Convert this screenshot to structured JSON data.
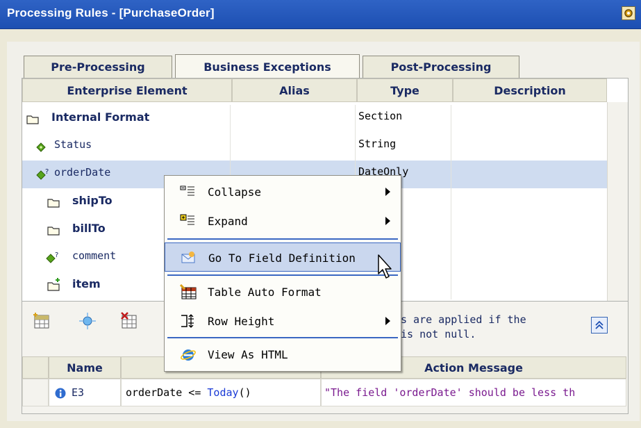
{
  "window": {
    "title": "Processing Rules - [PurchaseOrder]",
    "settings_icon": "gear-icon"
  },
  "tabs": [
    {
      "label": "Pre-Processing",
      "active": false
    },
    {
      "label": "Business Exceptions",
      "active": true
    },
    {
      "label": "Post-Processing",
      "active": false
    }
  ],
  "grid": {
    "columns": [
      "Enterprise Element",
      "Alias",
      "Type",
      "Description"
    ],
    "rows": [
      {
        "name": "Internal Format",
        "icon": "folder-icon",
        "type": "Section",
        "bold": true
      },
      {
        "name": "Status",
        "icon": "diamond-icon",
        "type": "String",
        "bold": false
      },
      {
        "name": "orderDate",
        "icon": "diamond-question-icon",
        "type": "DateOnly",
        "bold": false,
        "selected": true
      },
      {
        "name": "shipTo",
        "icon": "folder-icon",
        "type": "n",
        "bold": true
      },
      {
        "name": "billTo",
        "icon": "folder-icon",
        "type": "n",
        "bold": true
      },
      {
        "name": "comment",
        "icon": "diamond-question-icon",
        "type": "",
        "bold": false
      },
      {
        "name": "item",
        "icon": "folder-plus-icon",
        "type": "n",
        "bold": true
      }
    ]
  },
  "rules_panel": {
    "info_line1": "s are applied if the",
    "info_line2": "is not null.",
    "columns": [
      "Name",
      "Action Message"
    ],
    "rows": [
      {
        "name": "E3",
        "condition": "orderDate <= ",
        "func": "Today",
        "tail": "()",
        "message": "\"The field 'orderDate' should be less th"
      }
    ]
  },
  "context_menu": {
    "items": [
      {
        "label": "Collapse",
        "icon": "collapse-icon",
        "submenu": true
      },
      {
        "label": "Expand",
        "icon": "expand-icon",
        "submenu": true
      },
      {
        "label": "Go To Field Definition",
        "icon": "go-to-field-icon",
        "submenu": false,
        "highlighted": true
      },
      {
        "label": "Table Auto Format",
        "icon": "table-format-icon",
        "submenu": false
      },
      {
        "label": "Row Height",
        "icon": "row-height-icon",
        "submenu": true
      },
      {
        "label": "View As HTML",
        "icon": "internet-explorer-icon",
        "submenu": false
      }
    ]
  },
  "colors": {
    "title_bar": "#1d4fb2",
    "selection": "#cfdcf0",
    "menu_highlight": "#cad7ee",
    "function_blue": "#1a3ad6",
    "string_purple": "#7a1a8f"
  }
}
